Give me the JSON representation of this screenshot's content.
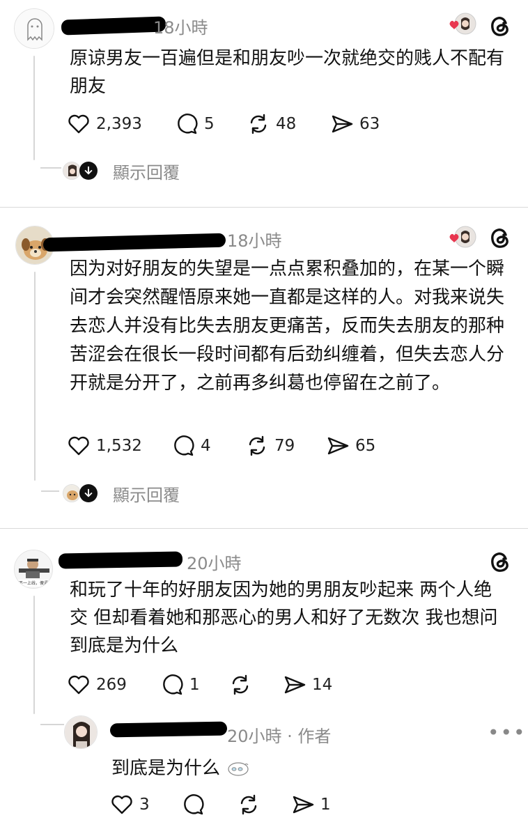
{
  "posts": [
    {
      "time": "18小時",
      "text": "原谅男友一百遍但是和朋友吵一次就绝交的贱人不配有朋友",
      "likes": "2,393",
      "comments": "5",
      "reposts": "48",
      "shares": "63",
      "replies_label": "顯示回覆",
      "has_liked_badge": true
    },
    {
      "time": "18小時",
      "text": "因为对好朋友的失望是一点点累积叠加的，在某一个瞬间才会突然醒悟原来她一直都是这样的人。对我来说失去恋人并没有比失去朋友更痛苦，反而失去朋友的那种苦涩会在很长一段时间都有后劲纠缠着，但失去恋人分开就是分开了，之前再多纠葛也停留在之前了。",
      "likes": "1,532",
      "comments": "4",
      "reposts": "79",
      "shares": "65",
      "replies_label": "顯示回覆",
      "has_liked_badge": true
    },
    {
      "time": "20小時",
      "text": "和玩了十年的好朋友因为她的男朋友吵起来 两个人绝交 但却看着她和那恶心的男人和好了无数次 我也想问到底是为什么",
      "likes": "269",
      "comments": "1",
      "reposts": "",
      "shares": "14",
      "has_liked_badge": false,
      "avatar_caption": "不一上线，傻逼"
    }
  ],
  "reply": {
    "time": "20小時 · 作者",
    "text": "到底是为什么",
    "likes": "3",
    "comments": "",
    "reposts": "",
    "shares": "1",
    "more_label": "•••"
  },
  "colors": {
    "like_heart": "#e8364f",
    "muted_text": "#8a8a8a",
    "divider": "#d9d9d9"
  }
}
